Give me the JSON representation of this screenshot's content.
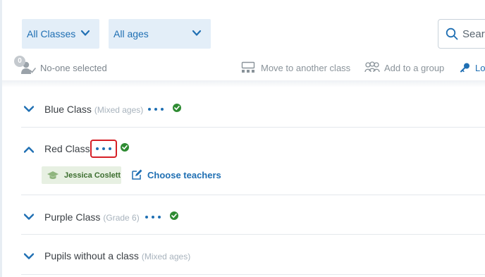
{
  "filters": {
    "class_filter": {
      "selected": "All Classes",
      "icon": "chevron-down-icon"
    },
    "age_filter": {
      "selected": "All ages",
      "icon": "chevron-down-icon"
    }
  },
  "search": {
    "label": "Searc",
    "icon": "search-icon"
  },
  "toolbar": {
    "selected_count": "0",
    "selection_text": "No-one selected",
    "move_label": "Move to another class",
    "group_label": "Add to a group",
    "login_label": "Lo"
  },
  "classes": [
    {
      "name": "Blue Class",
      "meta": "(Mixed ages)",
      "expanded": false,
      "has_menu": true,
      "status": "check"
    },
    {
      "name": "Red Class",
      "meta": "",
      "expanded": true,
      "has_menu": true,
      "status": "check",
      "teachers": [
        "Jessica Coslett"
      ],
      "choose_teachers_label": "Choose teachers"
    },
    {
      "name": "Purple Class",
      "meta": "(Grade 6)",
      "expanded": false,
      "has_menu": true,
      "status": "check"
    },
    {
      "name": "Pupils without a class",
      "meta": "(Mixed ages)",
      "expanded": false,
      "has_menu": false,
      "status": ""
    }
  ],
  "colors": {
    "accent": "#1f6fb3",
    "dropdown_bg": "#e3eef8",
    "success": "#2e8b32",
    "highlight": "#d61f26",
    "teacher_chip_bg": "#e7f0e2"
  }
}
